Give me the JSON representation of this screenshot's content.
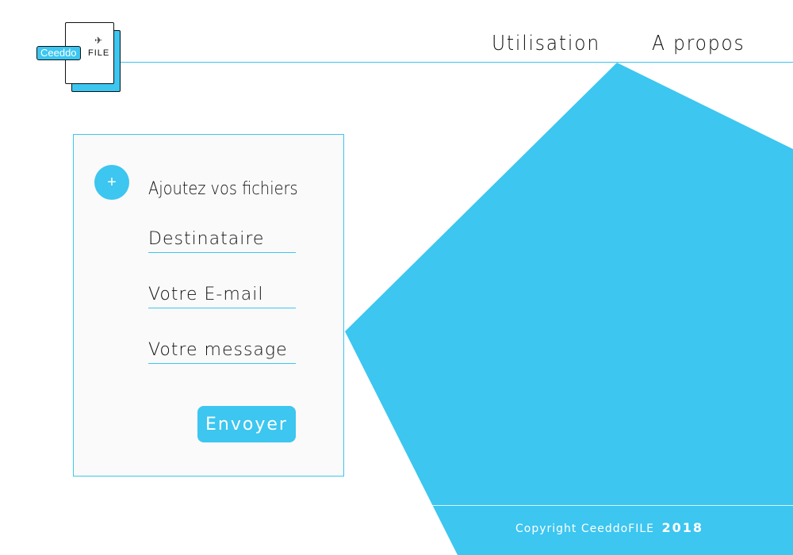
{
  "brand": {
    "pill_text": "Ceeddo",
    "suffix_text": "FILE",
    "accent_color": "#3cc6f0",
    "plane_icon": "paper-plane-icon"
  },
  "nav": {
    "items": [
      {
        "label": "Utilisation"
      },
      {
        "label": "A propos"
      }
    ]
  },
  "form": {
    "add_files_icon": "+",
    "add_files_label": "Ajoutez vos fichiers",
    "recipient_placeholder": "Destinataire",
    "email_placeholder": "Votre E-mail",
    "message_placeholder": "Votre message",
    "submit_label": "Envoyer"
  },
  "footer": {
    "copyright_text": "Copyright CeeddoFILE",
    "year": "2018"
  }
}
